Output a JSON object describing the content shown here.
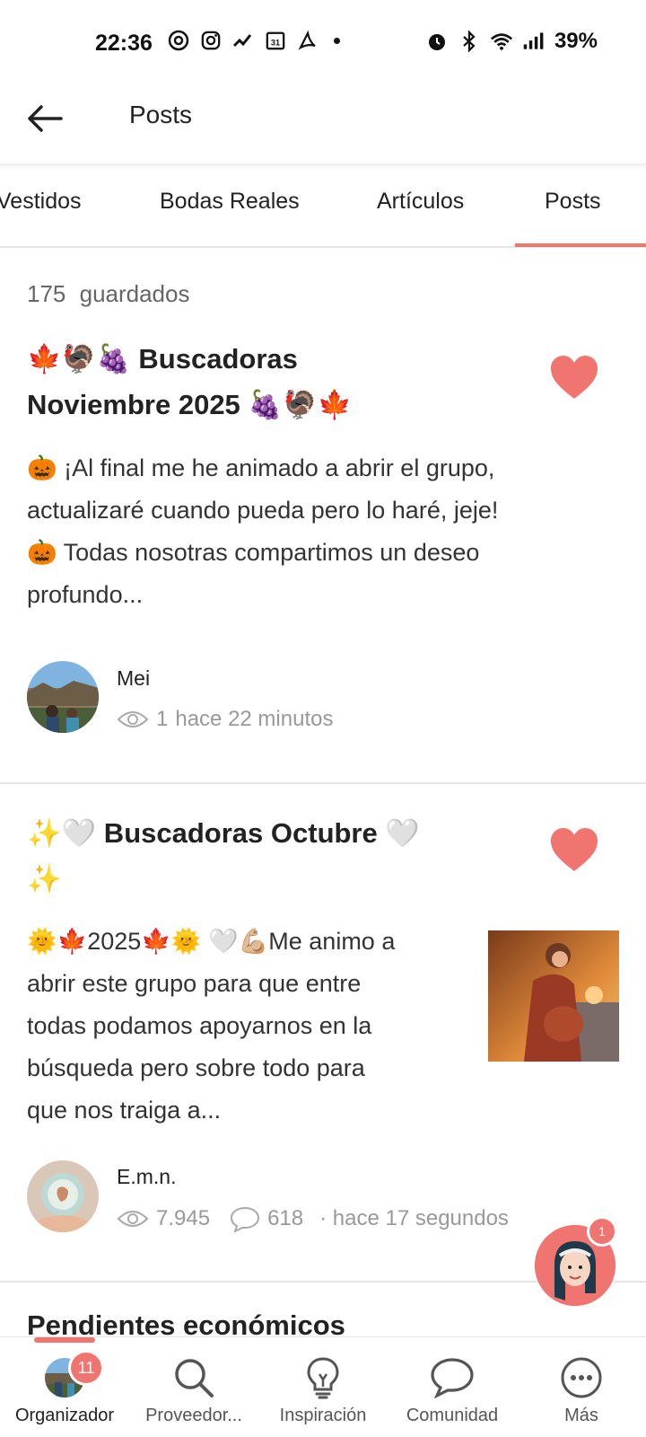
{
  "status_bar": {
    "time": "22:36",
    "battery": "39%",
    "icons_left": [
      "threads-icon",
      "instagram-icon",
      "call-missed-icon",
      "calendar-icon",
      "acrobat-icon"
    ],
    "icons_right": [
      "alarm-icon",
      "bluetooth-icon",
      "wifi-icon",
      "signal-icon"
    ]
  },
  "header": {
    "title": "Posts"
  },
  "tabs": [
    {
      "label": "Vestidos",
      "active": false
    },
    {
      "label": "Bodas Reales",
      "active": false
    },
    {
      "label": "Artículos",
      "active": false
    },
    {
      "label": "Posts",
      "active": true
    }
  ],
  "saved_count": "175 guardados",
  "posts": [
    {
      "title_line1": "🍁🦃🍇 Buscadoras",
      "title_line2": "Noviembre 2025 🍇🦃🍁",
      "body_lines": [
        "🎃 ¡Al final me he animado a abrir el grupo,",
        "actualizaré cuando pueda pero lo haré, jeje!",
        "🎃 Todas nosotras compartimos un deseo",
        "profundo..."
      ],
      "author": "Mei",
      "views": "1",
      "comments": "",
      "time": "hace 22 minutos",
      "liked": true
    },
    {
      "title_line1": "✨🤍 Buscadoras Octubre 🤍",
      "title_line2": "✨",
      "body_lines": [
        "🌞🍁2025🍁🌞 🤍💪🏼Me animo a",
        "abrir este grupo para que entre",
        "todas podamos apoyarnos en la",
        "búsqueda pero sobre todo para",
        "que nos traiga a..."
      ],
      "author": "E.m.n.",
      "views": "7.945",
      "comments": "618",
      "time": "· hace 17 segundos",
      "liked": true
    }
  ],
  "next_post_title_partial": "Pendientes económicos",
  "assistant_badge": "1",
  "bottom_nav": [
    {
      "label": "Organizador",
      "icon": "organizer-avatar-icon",
      "badge": "11",
      "active": true
    },
    {
      "label": "Proveedor...",
      "icon": "search-icon"
    },
    {
      "label": "Inspiración",
      "icon": "lightbulb-icon"
    },
    {
      "label": "Comunidad",
      "icon": "chat-bubble-icon"
    },
    {
      "label": "Más",
      "icon": "more-icon"
    }
  ],
  "colors": {
    "accent": "#f07570",
    "text": "#222222",
    "muted": "#999999"
  }
}
